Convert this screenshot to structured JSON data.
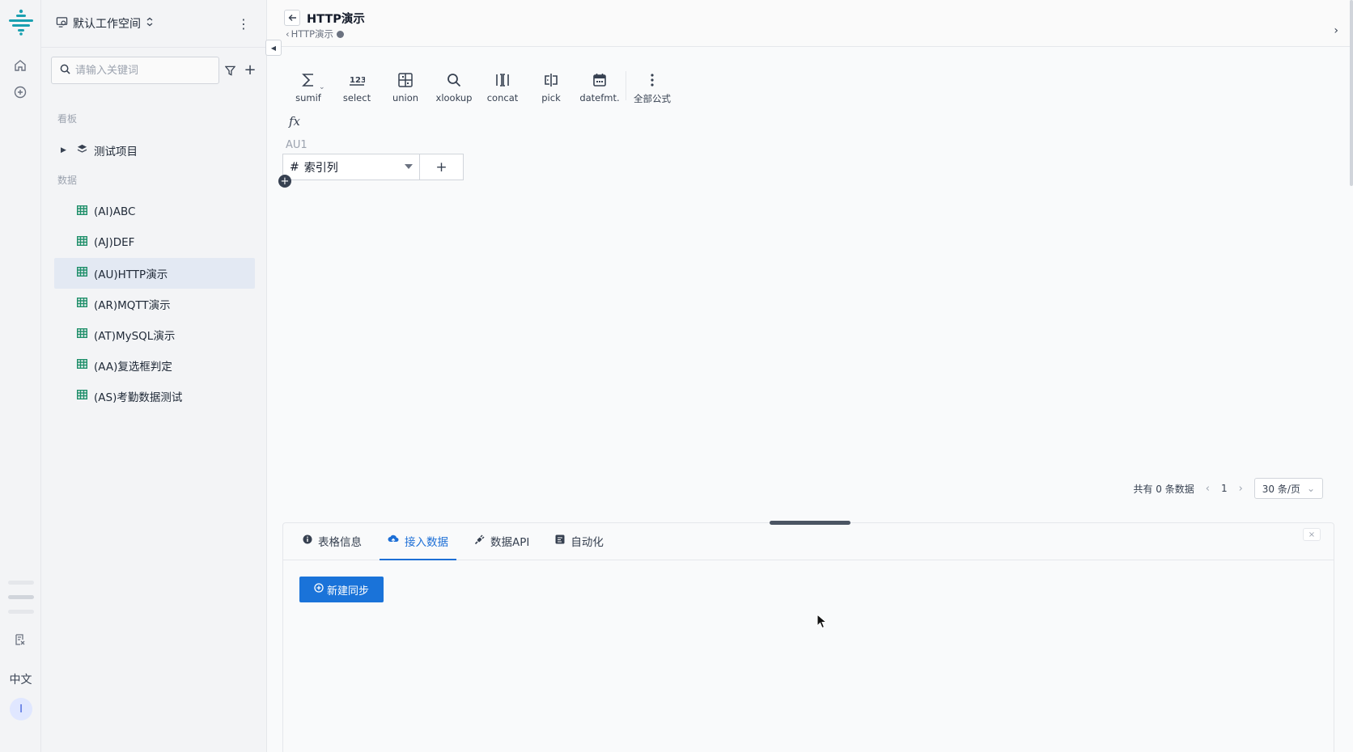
{
  "rail": {
    "language": "中文",
    "user_initial": "I"
  },
  "sidebar": {
    "workspace": "默认工作空间",
    "search_placeholder": "请输入关键词",
    "section_boards": "看板",
    "boards": [
      {
        "label": "测试项目"
      }
    ],
    "section_data": "数据",
    "tables": [
      {
        "label": "(AI)ABC",
        "active": false
      },
      {
        "label": "(AJ)DEF",
        "active": false
      },
      {
        "label": "(AU)HTTP演示",
        "active": true
      },
      {
        "label": "(AR)MQTT演示",
        "active": false
      },
      {
        "label": "(AT)MySQL演示",
        "active": false
      },
      {
        "label": "(AA)复选框判定",
        "active": false
      },
      {
        "label": "(AS)考勤数据测试",
        "active": false
      }
    ]
  },
  "header": {
    "title": "HTTP演示",
    "breadcrumb": "HTTP演示"
  },
  "toolbar": {
    "tools": [
      {
        "icon": "sigma-icon",
        "label": "sumif"
      },
      {
        "icon": "numbers-icon",
        "label": "select"
      },
      {
        "icon": "union-icon",
        "label": "union"
      },
      {
        "icon": "search-icon",
        "label": "xlookup"
      },
      {
        "icon": "concat-icon",
        "label": "concat"
      },
      {
        "icon": "pick-icon",
        "label": "pick"
      },
      {
        "icon": "calendar-icon",
        "label": "datefmt."
      },
      {
        "icon": "more-vertical-icon",
        "label": "全部公式"
      }
    ],
    "fx_symbol": "fx"
  },
  "table": {
    "id": "AU1",
    "column_type_symbol": "#",
    "column_name": "索引列",
    "add_symbol": "+"
  },
  "pager": {
    "total_text": "共有 0 条数据",
    "current_page": "1",
    "page_size": "30 条/页"
  },
  "panel": {
    "tabs": [
      {
        "icon": "info-icon",
        "label": "表格信息",
        "active": false
      },
      {
        "icon": "cloud-upload-icon",
        "label": "接入数据",
        "active": true
      },
      {
        "icon": "plug-icon",
        "label": "数据API",
        "active": false
      },
      {
        "icon": "automation-icon",
        "label": "自动化",
        "active": false
      }
    ],
    "new_sync_label": "新建同步"
  },
  "colors": {
    "accent": "#1a73d9",
    "active_row": "#e3e9f3",
    "logo": "#1aa0b0"
  }
}
